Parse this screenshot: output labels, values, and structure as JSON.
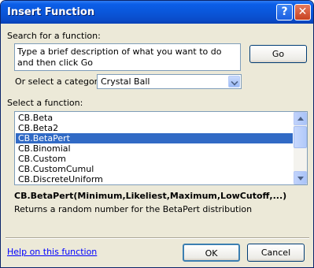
{
  "window": {
    "title": "Insert Function"
  },
  "titlebar": {
    "help_label": "?",
    "close_label": "✕"
  },
  "search": {
    "label": "Search for a function:",
    "value": "Type a brief description of what you want to do and then click Go",
    "go_label": "Go"
  },
  "category": {
    "label": "Or select a category:",
    "value": "Crystal Ball"
  },
  "functions": {
    "label": "Select a function:",
    "items": [
      "CB.Beta",
      "CB.Beta2",
      "CB.BetaPert",
      "CB.Binomial",
      "CB.Custom",
      "CB.CustomCumul",
      "CB.DiscreteUniform"
    ],
    "selected_index": 2
  },
  "details": {
    "signature": "CB.BetaPert(Minimum,Likeliest,Maximum,LowCutoff,...)",
    "description": "Returns a random number for the BetaPert distribution"
  },
  "footer": {
    "help_link": "Help on this function",
    "ok_label": "OK",
    "cancel_label": "Cancel"
  },
  "icons": {
    "help": "help-icon",
    "close": "close-icon",
    "dropdown": "chevron-down-icon",
    "scroll_up": "scroll-up-arrow",
    "scroll_down": "scroll-down-arrow"
  },
  "colors": {
    "title_bar": "#0a55d8",
    "selection": "#316ac5",
    "dialog_bg": "#ece9d8",
    "link": "#0000ff"
  }
}
